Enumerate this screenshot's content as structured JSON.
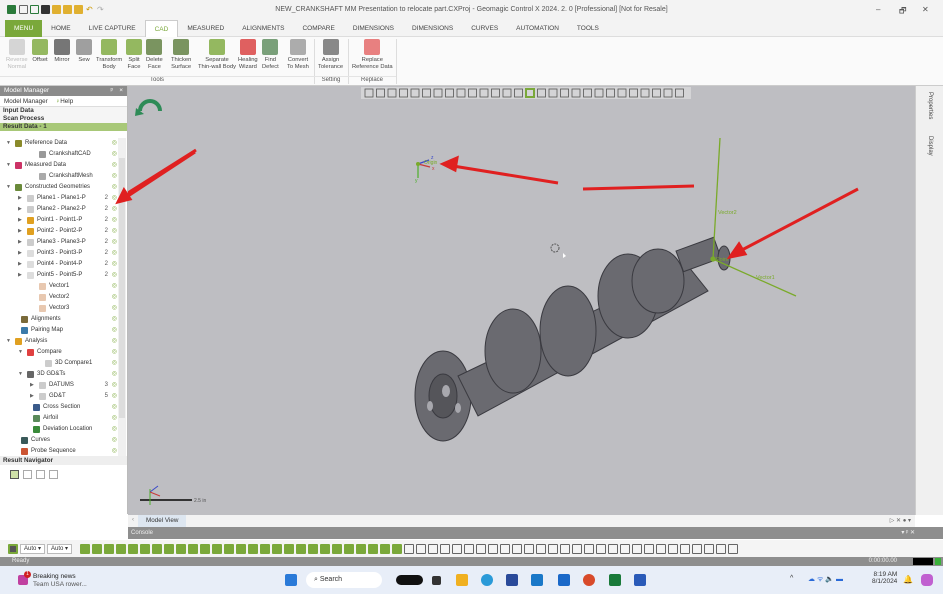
{
  "window": {
    "title": "NEW_CRANKSHAFT MM Presentation to relocate part.CXProj - Geomagic Control X 2024. 2. 0 [Professional] [Not for Resale]",
    "minimize": "–",
    "restore": "🗗",
    "close": "✕"
  },
  "tabs": [
    "MENU",
    "HOME",
    "LIVE CAPTURE",
    "CAD",
    "MEASURED",
    "ALIGNMENTS",
    "COMPARE",
    "DIMENSIONS",
    "DIMENSIONS",
    "CURVES",
    "AUTOMATION",
    "TOOLS"
  ],
  "active_tab": "CAD",
  "ribbon": {
    "tools": [
      {
        "l1": "Reverse",
        "l2": "Normal",
        "disabled": true
      },
      {
        "l1": "Offset",
        "l2": ""
      },
      {
        "l1": "Mirror",
        "l2": ""
      },
      {
        "l1": "Sew",
        "l2": ""
      },
      {
        "l1": "Transform",
        "l2": "Body"
      },
      {
        "l1": "Split",
        "l2": "Face"
      },
      {
        "l1": "Delete",
        "l2": "Face"
      },
      {
        "l1": "Thicken",
        "l2": "Surface"
      },
      {
        "l1": "Separate",
        "l2": "Thin-wall Body"
      },
      {
        "l1": "Healing",
        "l2": "Wizard"
      },
      {
        "l1": "Find",
        "l2": "Defect"
      },
      {
        "l1": "Convert",
        "l2": "To Mesh"
      }
    ],
    "setting": [
      {
        "l1": "Assign",
        "l2": "Tolerance"
      }
    ],
    "replace": [
      {
        "l1": "Replace",
        "l2": "Reference Data"
      }
    ],
    "groups": {
      "tools": "Tools",
      "setting": "Setting",
      "replace": "Replace"
    }
  },
  "model_manager": {
    "header": "Model Manager",
    "pin": "ᵖ",
    "close": "×",
    "tab_model": "Model Manager",
    "tab_help": "Help",
    "input_data": "Input Data",
    "scan_process": "Scan Process",
    "result_data": "Result Data - 1",
    "tree": [
      {
        "label": "Reference Data",
        "level": 0,
        "exp": "▼",
        "color": "#8a8a2a",
        "count": ""
      },
      {
        "label": "CrankshaftCAD",
        "level": 2,
        "exp": "",
        "color": "#999",
        "count": ""
      },
      {
        "label": "Measured Data",
        "level": 0,
        "exp": "▼",
        "color": "#cc3366",
        "count": ""
      },
      {
        "label": "CrankshaftMesh",
        "level": 2,
        "exp": "",
        "color": "#aaa",
        "count": ""
      },
      {
        "label": "Constructed Geometries",
        "level": 0,
        "exp": "▼",
        "color": "#6a8a3a",
        "count": ""
      },
      {
        "label": "Plane1 - Plane1-P",
        "level": 1,
        "exp": "▶",
        "color": "#ccc",
        "count": "2"
      },
      {
        "label": "Plane2 - Plane2-P",
        "level": 1,
        "exp": "▶",
        "color": "#ccc",
        "count": "2"
      },
      {
        "label": "Point1 - Point1-P",
        "level": 1,
        "exp": "▶",
        "color": "#e0a020",
        "count": "2"
      },
      {
        "label": "Point2 - Point2-P",
        "level": 1,
        "exp": "▶",
        "color": "#e0a020",
        "count": "2"
      },
      {
        "label": "Plane3 - Plane3-P",
        "level": 1,
        "exp": "▶",
        "color": "#ccc",
        "count": "2"
      },
      {
        "label": "Point3 - Point3-P",
        "level": 1,
        "exp": "▶",
        "color": "#ddd",
        "count": "2"
      },
      {
        "label": "Point4 - Point4-P",
        "level": 1,
        "exp": "▶",
        "color": "#ddd",
        "count": "2"
      },
      {
        "label": "Point5 - Point5-P",
        "level": 1,
        "exp": "▶",
        "color": "#ddd",
        "count": "2"
      },
      {
        "label": "Vector1",
        "level": 2,
        "exp": "",
        "color": "#e8c8b0",
        "count": ""
      },
      {
        "label": "Vector2",
        "level": 2,
        "exp": "",
        "color": "#e8c8b0",
        "count": ""
      },
      {
        "label": "Vector3",
        "level": 2,
        "exp": "",
        "color": "#e8c8b0",
        "count": ""
      },
      {
        "label": "Alignments",
        "level": 0.5,
        "exp": "",
        "color": "#7a6a3a",
        "count": ""
      },
      {
        "label": "Pairing Map",
        "level": 0.5,
        "exp": "",
        "color": "#3a7aaa",
        "count": ""
      },
      {
        "label": "Analysis",
        "level": 0,
        "exp": "▼",
        "color": "#e0a020",
        "count": ""
      },
      {
        "label": "Compare",
        "level": 1,
        "exp": "▼",
        "color": "#e04040",
        "count": ""
      },
      {
        "label": "3D Compare1",
        "level": 2.5,
        "exp": "",
        "color": "#ccc",
        "count": ""
      },
      {
        "label": "3D GD&Ts",
        "level": 1,
        "exp": "▼",
        "color": "#666",
        "count": ""
      },
      {
        "label": "DATUMS",
        "level": 2,
        "exp": "▶",
        "color": "#ccc",
        "count": "3"
      },
      {
        "label": "GD&T",
        "level": 2,
        "exp": "▶",
        "color": "#ccc",
        "count": "5"
      },
      {
        "label": "Cross Section",
        "level": 1.5,
        "exp": "",
        "color": "#3a5a8a",
        "count": ""
      },
      {
        "label": "Airfoil",
        "level": 1.5,
        "exp": "",
        "color": "#5a8a5a",
        "count": ""
      },
      {
        "label": "Deviation Location",
        "level": 1.5,
        "exp": "",
        "color": "#3a8a3a",
        "count": ""
      },
      {
        "label": "Curves",
        "level": 0.5,
        "exp": "",
        "color": "#3a5a5a",
        "count": ""
      },
      {
        "label": "Probe Sequence",
        "level": 0.5,
        "exp": "",
        "color": "#cc5533",
        "count": ""
      }
    ],
    "result_navigator": "Result Navigator"
  },
  "viewport": {
    "origin_label": "Origin",
    "axis_z": "z",
    "axis_x": "x",
    "axis_y": "y",
    "vector1": "Vector1",
    "vector2": "Vector2",
    "point_label": "Point",
    "scale_label": "2.5 in",
    "background": "#bebec2",
    "arrow_color": "#e02020",
    "geometry_color": "#7aaa2a"
  },
  "right_panel": {
    "properties": "Properties",
    "display": "Display"
  },
  "model_view_tab": "Model View",
  "console": "Console",
  "bottom_toolbar": {
    "select1": "Auto",
    "select2": "Auto"
  },
  "status": {
    "text": "Ready",
    "timer": "0:00:00.00"
  },
  "taskbar": {
    "news_title": "Breaking news",
    "news_sub": "Team USA rower...",
    "news_badge": "1",
    "search": "Search",
    "time": "8:19 AM",
    "date": "8/1/2024"
  }
}
